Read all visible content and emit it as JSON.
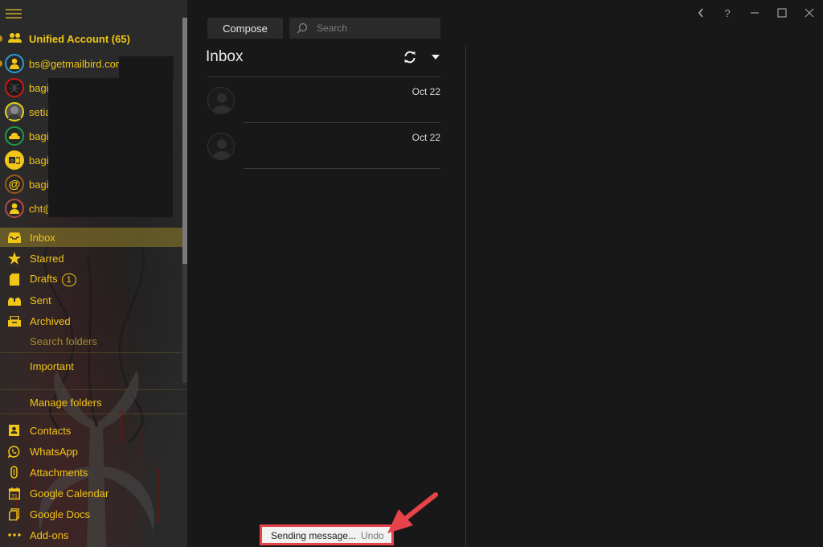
{
  "window": {
    "controls": [
      {
        "name": "back",
        "icon": "chevron-left-icon",
        "glyph": "‹"
      },
      {
        "name": "help",
        "icon": "help-icon",
        "glyph": "?"
      },
      {
        "name": "minimize",
        "icon": "minimize-icon",
        "glyph": "—"
      },
      {
        "name": "maximize",
        "icon": "maximize-icon",
        "glyph": "☐"
      },
      {
        "name": "close",
        "icon": "close-icon",
        "glyph": "✕"
      }
    ]
  },
  "sidebar": {
    "accounts": [
      {
        "label": "Unified Account (65)",
        "icon": "people-icon",
        "ring": "none",
        "bold": true
      },
      {
        "label": "bs@getmailbird.com",
        "icon": "person-icon",
        "ring": "#2a9ad8"
      },
      {
        "label": "bagi",
        "icon": "spider-avatar",
        "ring": "#d01818"
      },
      {
        "label": "setia",
        "icon": "photo-avatar",
        "ring": "#e6d21a"
      },
      {
        "label": "bagi",
        "icon": "cloud-icon",
        "ring": "#1f9a4a"
      },
      {
        "label": "bagi",
        "icon": "outlook-icon",
        "ring": "#f2c616"
      },
      {
        "label": "bagi",
        "icon": "at-icon",
        "ring": "#9a5a1a"
      },
      {
        "label": "cht@",
        "icon": "person-icon",
        "ring": "#b84848"
      }
    ],
    "folders": [
      {
        "label": "Inbox",
        "icon": "inbox-icon",
        "active": true
      },
      {
        "label": "Starred",
        "icon": "star-icon"
      },
      {
        "label": "Drafts",
        "icon": "drafts-icon",
        "badge": "1"
      },
      {
        "label": "Sent",
        "icon": "sent-icon"
      },
      {
        "label": "Archived",
        "icon": "archive-icon"
      }
    ],
    "search_folders": "Search folders",
    "important": "Important",
    "manage_folders": "Manage folders",
    "apps": [
      {
        "label": "Contacts",
        "icon": "contacts-icon"
      },
      {
        "label": "WhatsApp",
        "icon": "whatsapp-icon"
      },
      {
        "label": "Attachments",
        "icon": "attachment-icon"
      },
      {
        "label": "Google Calendar",
        "icon": "calendar-icon"
      },
      {
        "label": "Google Docs",
        "icon": "docs-icon"
      },
      {
        "label": "Add-ons",
        "icon": "more-icon"
      }
    ],
    "accent_color": "#f2c616"
  },
  "toolbar": {
    "compose_label": "Compose",
    "search_placeholder": "Search"
  },
  "inbox": {
    "title": "Inbox",
    "messages": [
      {
        "date": "Oct 22"
      },
      {
        "date": "Oct 22"
      }
    ]
  },
  "toast": {
    "message": "Sending message...",
    "undo_label": "Undo"
  }
}
